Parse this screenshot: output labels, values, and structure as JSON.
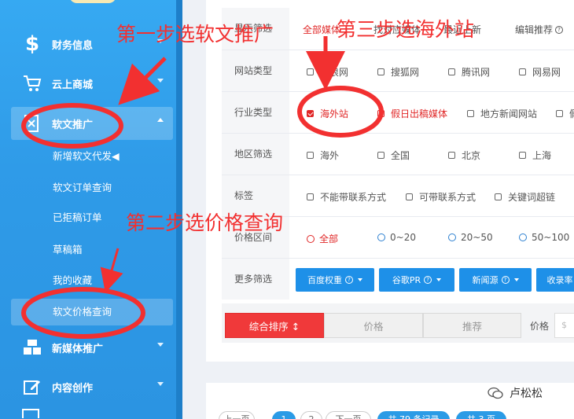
{
  "sidebar": {
    "items": [
      {
        "label": "财务信息",
        "icon": "dollar-icon"
      },
      {
        "label": "云上商城",
        "icon": "cart-icon"
      },
      {
        "label": "软文推广",
        "icon": "document-x-icon"
      },
      {
        "label": "新媒体推广",
        "icon": "cubes-icon"
      },
      {
        "label": "内容创作",
        "icon": "edit-icon"
      }
    ],
    "subitems": [
      "新增软文代发◀",
      "软文订单查询",
      "已拒稿订单",
      "草稿箱",
      "我的收藏",
      "软文价格查询"
    ]
  },
  "filters": {
    "top_tabs": [
      "显示筛选",
      "全部媒体",
      "找对应媒体",
      "最近上新",
      "编辑推荐"
    ],
    "rows": [
      {
        "label": "网站类型",
        "options": [
          "新浪网",
          "搜狐网",
          "腾讯网",
          "网易网"
        ]
      },
      {
        "label": "行业类型",
        "options": [
          "海外站",
          "假日出稿媒体",
          "地方新闻网站",
          "假"
        ]
      },
      {
        "label": "地区筛选",
        "options": [
          "海外",
          "全国",
          "北京",
          "上海"
        ]
      },
      {
        "label": "标签",
        "options": [
          "不能带联系方式",
          "可带联系方式",
          "关键词超链"
        ]
      },
      {
        "label": "价格区间",
        "options": [
          "全部",
          "0~20",
          "20~50",
          "50~100"
        ]
      }
    ],
    "more": {
      "label": "更多筛选",
      "buttons": [
        "百度权重",
        "谷歌PR",
        "新闻源",
        "收录率"
      ]
    }
  },
  "sort": {
    "buttons": [
      "综合排序 ↕",
      "价格",
      "推荐"
    ],
    "price_label": "价格",
    "price_placeholder": "$"
  },
  "pagination": [
    "上一页",
    "1",
    "2",
    "下一页",
    "共 79 条记录",
    "共 3 页"
  ],
  "watermark": "卢松松",
  "annotations": {
    "step1": "第一步选软文推广",
    "step2": "第二步选价格查询",
    "step3": "第三步选海外站"
  },
  "colors": {
    "sidebar": "#2f9be8",
    "accent_red": "#e02626",
    "button_blue": "#1e90e8"
  }
}
